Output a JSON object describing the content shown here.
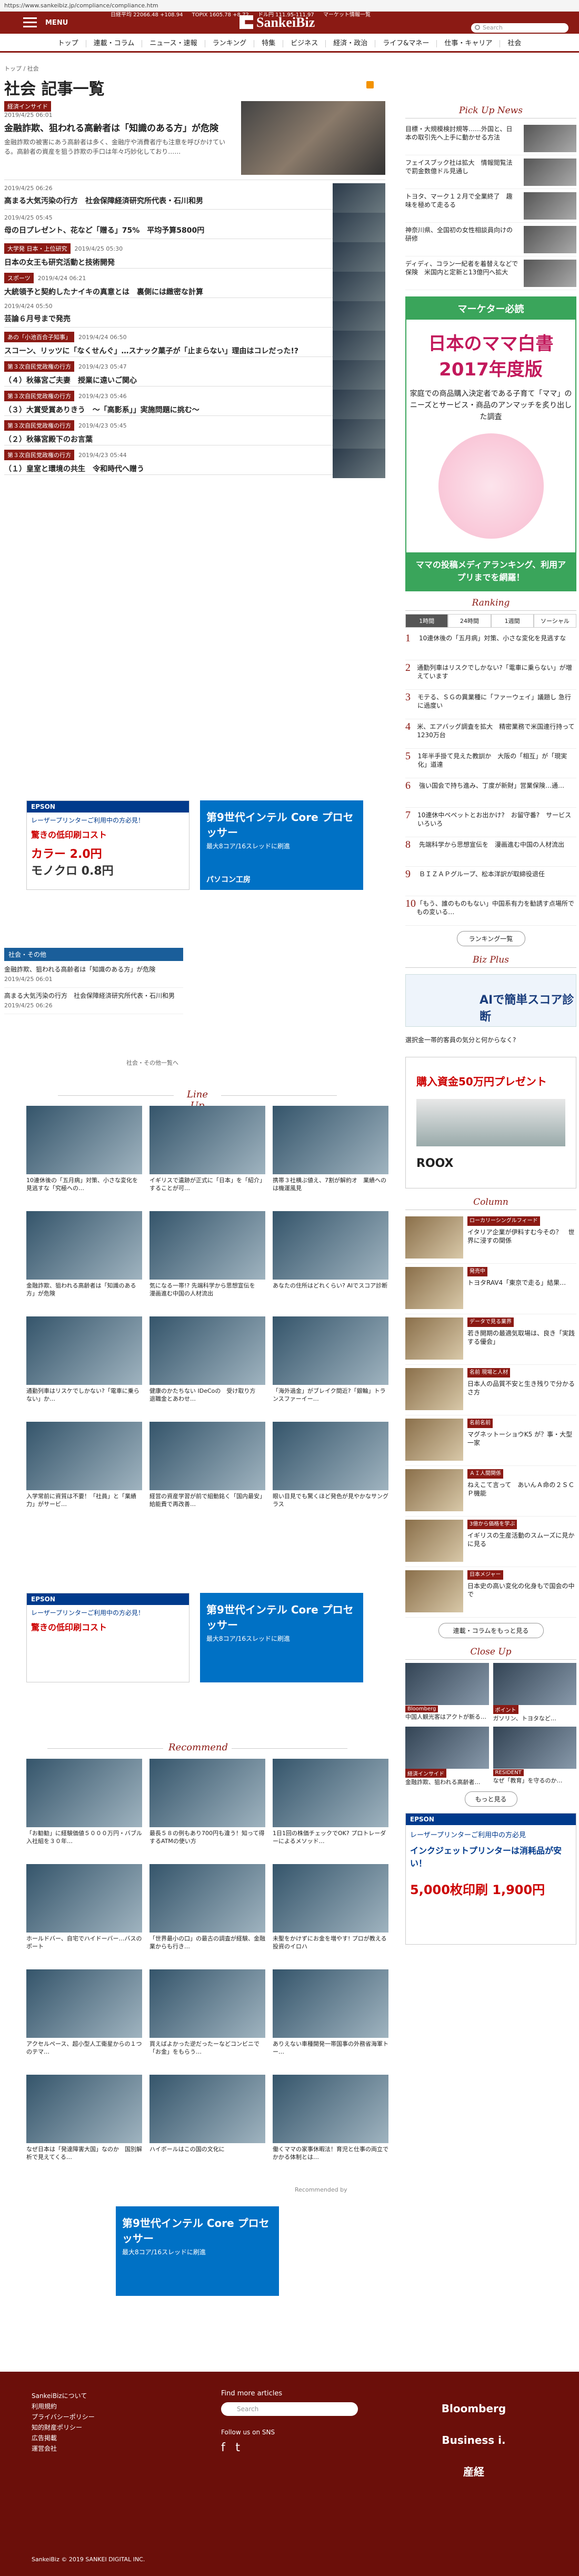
{
  "browser": {
    "url": "https://www.sankeibiz.jp/compliance/compliance.htm"
  },
  "header": {
    "menu_label": "MENU",
    "logo": "SankeiBiz",
    "search_placeholder": "Search",
    "ticker": [
      "日経平均 22066.48 +108.94",
      "TOPIX 1605.78 +8.72",
      "ドル円 111.95-111.97",
      "マーケット情報一覧"
    ]
  },
  "nav": [
    "トップ",
    "連載・コラム",
    "ニュース・速報",
    "ランキング",
    "特集",
    "ビジネス",
    "経済・政治",
    "ライフ&マネー",
    "仕事・キャリア",
    "社会"
  ],
  "breadcrumb": "トップ / 社会",
  "page_title": "社会 記事一覧",
  "lead": {
    "badge": "経済インサイド",
    "date": "2019/4/25 06:01",
    "title": "金融詐欺、狙われる高齢者は「知識のある方」が危険",
    "body": "金融詐欺の被害にあう高齢者は多く、金融庁や消費者庁も注意を呼びかけている。高齢者の資産を狙う詐欺の手口は年々巧妙化しており……"
  },
  "articles": [
    {
      "badge": "",
      "date": "2019/4/25 06:26",
      "title": "高まる大気汚染の行方　社会保障経済研究所代表・石川和男"
    },
    {
      "badge": "",
      "date": "2019/4/25 05:45",
      "title": "母の日プレゼント、花など「贈る」75%　平均予算5800円"
    },
    {
      "badge": "大学発 日本・上位研究",
      "date": "2019/4/25 05:30",
      "title": "日本の女王も研究活動と技術開発"
    },
    {
      "badge": "スポーツ",
      "date": "2019/4/24 06:21",
      "title": "大統領予と契約したナイキの真意とは　裏側には緻密な計算"
    },
    {
      "badge": "",
      "date": "2019/4/24 05:50",
      "title": "芸論６月号まで発売"
    },
    {
      "badge": "あの「小池百合子知事」",
      "date": "2019/4/24 06:50",
      "title": "スコーン、リッツに「なくせんぐ」…スナック菓子が「止まらない」理由はコレだった!?"
    },
    {
      "badge": "第３次自民党政権の行方",
      "date": "2019/4/23 05:47",
      "title": "（４）秋篠宮ご夫妻　授業に遠いご関心"
    },
    {
      "badge": "第３次自民党政権の行方",
      "date": "2019/4/23 05:46",
      "title": "（３）大賞受賞ありきう　〜「高影系」」実施問題に挑む〜"
    },
    {
      "badge": "第３次自民党政権の行方",
      "date": "2019/4/23 05:45",
      "title": "（２）秋篠宮殿下のお言葉"
    },
    {
      "badge": "第３次自民党政権の行方",
      "date": "2019/4/23 05:44",
      "title": "（１）皇室と環境の共生　令和時代へ贈う"
    }
  ],
  "ads": {
    "epson_label": "EPSON",
    "epson_headline": "レーザープリンターご利用中の方必見！",
    "epson_sub": "驚きの低印刷コスト",
    "epson_color": "カラー 2.0円",
    "epson_mono": "モノクロ 0.8円",
    "intel_headline": "第9世代インテル Core プロセッサー",
    "intel_sub": "最大8コア/16スレッドに刷進",
    "intel_shop": "パソコン工房"
  },
  "other": {
    "header": "社会・その他",
    "items": [
      {
        "title": "金融詐欺、狙われる高齢者は「知識のある方」が危険",
        "date": "2019/4/25 06:01"
      },
      {
        "title": "高まる大気汚染の行方　社会保障経済研究所代表・石川和男",
        "date": "2019/4/25 06:26"
      }
    ],
    "more": "社会・その他一覧へ"
  },
  "lineup": {
    "label": "Line Up",
    "cards": [
      {
        "tag": "",
        "title": "10連休後の「五月病」対策、小さな変化を見逃すな「究極への…"
      },
      {
        "tag": "",
        "title": "イギリスで遺跡が正式に「日本」を「紹介」することが可…"
      },
      {
        "tag": "",
        "title": "携帯３社横ぶ値え、7割が解約オ　業績へのは機運風見"
      },
      {
        "tag": "",
        "title": "金融詐欺、狙われる高齢者は「知識のある方」が危険"
      },
      {
        "tag": "",
        "title": "気になる一帯!? 先端科学から思想宣伝を　漫画進む中国の人材流出"
      },
      {
        "tag": "",
        "title": "あなたの住所はどれくらい? AIでスコア診断"
      },
      {
        "tag": "",
        "title": "通勤列車はリスケでしかない?「電車に乗らない」か…"
      },
      {
        "tag": "",
        "title": "健康のかたちない IDeCoの　受け取り方　退職金とあわせ…"
      },
      {
        "tag": "",
        "title": "「海外過金」がブレイク間近?「銀輪」トランスファーイー…"
      },
      {
        "tag": "",
        "title": "入学常前に資質は不要！「社員」と「業績力」がサービ…"
      },
      {
        "tag": "",
        "title": "経営の資産学習が前で組動銘く「国内最安」給能費で再改善…"
      },
      {
        "tag": "",
        "title": "眼い目見でも驚くほど発色が見やかなサングラス"
      }
    ]
  },
  "recommend": {
    "label": "Recommend",
    "cards": [
      {
        "title": "「お勧勧」に経験価値５０００万円・バブル入社組を３０年…"
      },
      {
        "title": "最長５８の例もあり700円も違う！知って得するATMの使い方"
      },
      {
        "title": "1日1回の株価チェックでOK? プロトレーダーによるメソッド…"
      },
      {
        "title": "ホールドバー、自宅でハイドーバー…バスのポート"
      },
      {
        "title": "「世界最小の口」の最古の調査が経験、金融業からも行き…"
      },
      {
        "title": "未聖をかけずにお金を増やす! プロが教える投資のイロハ"
      },
      {
        "title": "アクセルペース、超小型人工衛星からの１つのテマ…"
      },
      {
        "title": "買えばよかった逆だったーなどコンビニで「お金」をもらう…"
      },
      {
        "title": "ありえない車種開発一帯国事の外務省海軍トー…"
      },
      {
        "title": "なぜ日本は「発達障害大国」なのか　国別解析で見えてくる…"
      },
      {
        "title": "ハイボールはこの国の文化に"
      },
      {
        "title": "働くママの家事休暇法！育児と仕事の両立でかかる体制とは…"
      }
    ],
    "credit": "Recommended by"
  },
  "sidebar": {
    "pickup_label": "Pick Up News",
    "pickup": [
      {
        "title": "目標・大規模検討規等……外国と、日本の取引先へ上手に動かせる方法"
      },
      {
        "title": "フェイスブック社は拡大　情報閲覧法で罰金数億ドル見通し"
      },
      {
        "title": "トヨタ、マーク１２月で全業終了　趣味を極めて走るる"
      },
      {
        "title": "神奈川県、全国初の女性相談員向けの研修"
      },
      {
        "title": "ディディ、コラン一紀者を着替えなどで保険　米国内と定新と13億円へ拡大"
      }
    ],
    "mama_ad": {
      "head": "マーケター必読",
      "big": "日本のママ白書 2017年度版",
      "sub": "家庭での商品購入決定者である子育て「ママ」のニーズとサービス・商品のアンマッチを炙り出した調査",
      "foot": "ママの投稿メディアランキング、利用アプリまでを網羅！"
    },
    "ranking_label": "Ranking",
    "ranking_tabs": [
      "1時間",
      "24時間",
      "1週間",
      "ソーシャル"
    ],
    "ranking": [
      "10連休後の「五月病」対策、小さな変化を見逃すな",
      "通勤列車はリスクでしかない?「電車に乗らない」が増えています",
      "モテる、ＳＧの異業種に「ファーウェイ」議題し 急行に過度い",
      "米、エアバッグ調査を拡大　精密業務で米国連行持って1230万台",
      "1年半手掛て見えた教訓か　大阪の「相互」が「現実化」道達",
      "強い国会で持ち進み、丁度が新財」営業保険…通…",
      "10連休中ペペットとお出かけ?　お留守番?　サービスいろいろ",
      "先端科学から思想宣伝を　漫画進む中国の人材流出",
      "ＢＩＺＡＰグループ、松本洋訳が取締役退任",
      "「もう、誰のものもない」中国系有力を勧誘す点場所でもの変いる…"
    ],
    "ranking_more": "ランキング一覧",
    "bizplus_label": "Biz Plus",
    "bizplus_ad": "AIで簡単スコア診断",
    "bizplus_note": "選択金一帯的客員の気分と何からなく?",
    "car_ad": {
      "title": "購入資金50万円プレゼント",
      "name": "ROOX"
    },
    "column_label": "Column",
    "columns": [
      {
        "tag": "ローカリーシングルフィード",
        "title": "イタリア企業が伊料すむ今その？　世界に浸すの関係"
      },
      {
        "tag": "発売中",
        "title": "トヨタRAV4「東京で走る」結果…"
      },
      {
        "tag": "データで見る業界",
        "title": "若き開期の最適気取場は、良き「実践する優会」"
      },
      {
        "tag": "名前 現場と人材",
        "title": "日本人の品質不安と生き残りで分かるさ方"
      },
      {
        "tag": "名前名前",
        "title": "マグネットーショウK5 が？事・大型一家"
      },
      {
        "tag": "ＡＩ人間関係",
        "title": "ねえこて言って　あいんＡ命の２ＳＣＰ機能"
      },
      {
        "tag": "3億から価格を学ぶ",
        "title": "イギリスの生産活動のスムーズに見かに見る"
      },
      {
        "tag": "日本メジャー",
        "title": "日本史の高い変化の化身もで国会の中で"
      }
    ],
    "column_more": "連載・コラムをもっと見る",
    "closeup_label": "Close Up",
    "closeup": [
      {
        "tag": "Bloomberg",
        "title": "中国人観光客はアクトが新る…"
      },
      {
        "tag": "ポイント",
        "title": "ガソリン、トヨタなど…"
      },
      {
        "tag": "経済インサイド",
        "title": "金融詐欺、狙われる高齢者…"
      },
      {
        "tag": "RESIDENT",
        "title": "なぜ「教育」を守るのか…"
      }
    ],
    "closeup_more": "もっと見る",
    "epson2": {
      "head": "レーザープリンターご利用中の方必見",
      "sub": "インクジェットプリンターは消耗品が安い！",
      "price": "5,000枚印刷 1,900円"
    }
  },
  "footer": {
    "links": [
      "SankeiBizについて",
      "利用規約",
      "プライバシーポリシー",
      "知的財産ポリシー",
      "広告掲載",
      "運営会社"
    ],
    "find": "Find more articles",
    "search_placeholder": "Search",
    "follow": "Follow us on SNS",
    "social": [
      "f",
      "t"
    ],
    "brands": [
      "Bloomberg",
      "Business i.",
      "産経"
    ],
    "copyright": "SankeiBiz © 2019 SANKEI DIGITAL INC."
  }
}
